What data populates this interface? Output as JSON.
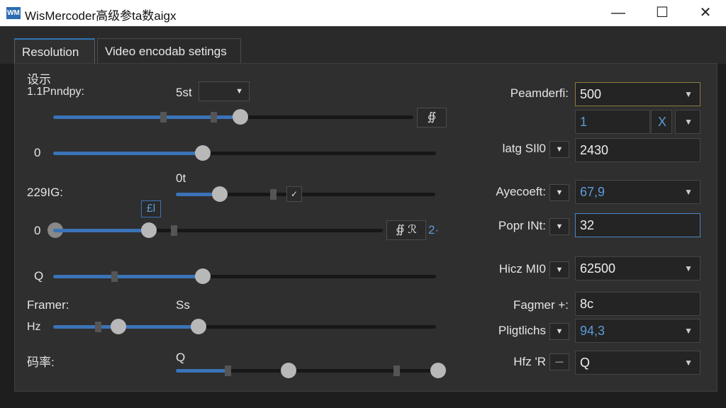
{
  "window": {
    "title": "WisMercoder高级参ta数aigx",
    "icon": "WM",
    "minimize": "—",
    "maximize": "☐",
    "close": "✕"
  },
  "tabs": [
    {
      "label": "Resolution"
    },
    {
      "label": "Video encodab setings"
    }
  ],
  "left": {
    "section_title": "设示",
    "row1_label": "1.1Pnndpy:",
    "row1_value": "5st",
    "row1_btn": "∯",
    "row2_value": "0",
    "row3_label": "229IG:",
    "row3_value": "0t",
    "row3_btn": "✓",
    "row4_badge": "£l",
    "row4_value": "0",
    "row4_btn": "∯ ℛ",
    "row4_suffix": "2·",
    "row5_value": "Q",
    "framer_label": "Framer:",
    "framer_value": "Ss",
    "hz_label": "Hz",
    "bitrate_label": "码率:",
    "bitrate_value": "Q"
  },
  "right": {
    "param_label": "Peamderfi:",
    "param_value": "500",
    "sub_value": "1",
    "sub_btn": "X",
    "latg_label": "latg SIl0",
    "latg_value": "2430",
    "aspect_label": "Ayecoeft:",
    "aspect_value": "67,9",
    "popr_label": "Popr INt:",
    "popr_value": "32",
    "hicz_label": "Hicz MI0",
    "hicz_value": "62500",
    "fagmer_label": "Fagmer +:",
    "fagmer_value": "8c",
    "pligt_label": "Pligtlichs",
    "pligt_value": "94,3",
    "hfz_label": "Hfz 'R",
    "hfz_dd": "—",
    "hfz_value": "Q"
  },
  "sliders": {
    "row1": 0.52,
    "row2": 0.39,
    "row3": 0.17,
    "row4": 0.29,
    "row5": 0.39,
    "hz_a": 0.17,
    "hz_b": 0.38,
    "bitrate_a": 0.43,
    "bitrate_b": 1.0
  },
  "colors": {
    "accent": "#3a73b8",
    "background": "#2f2f2f"
  }
}
